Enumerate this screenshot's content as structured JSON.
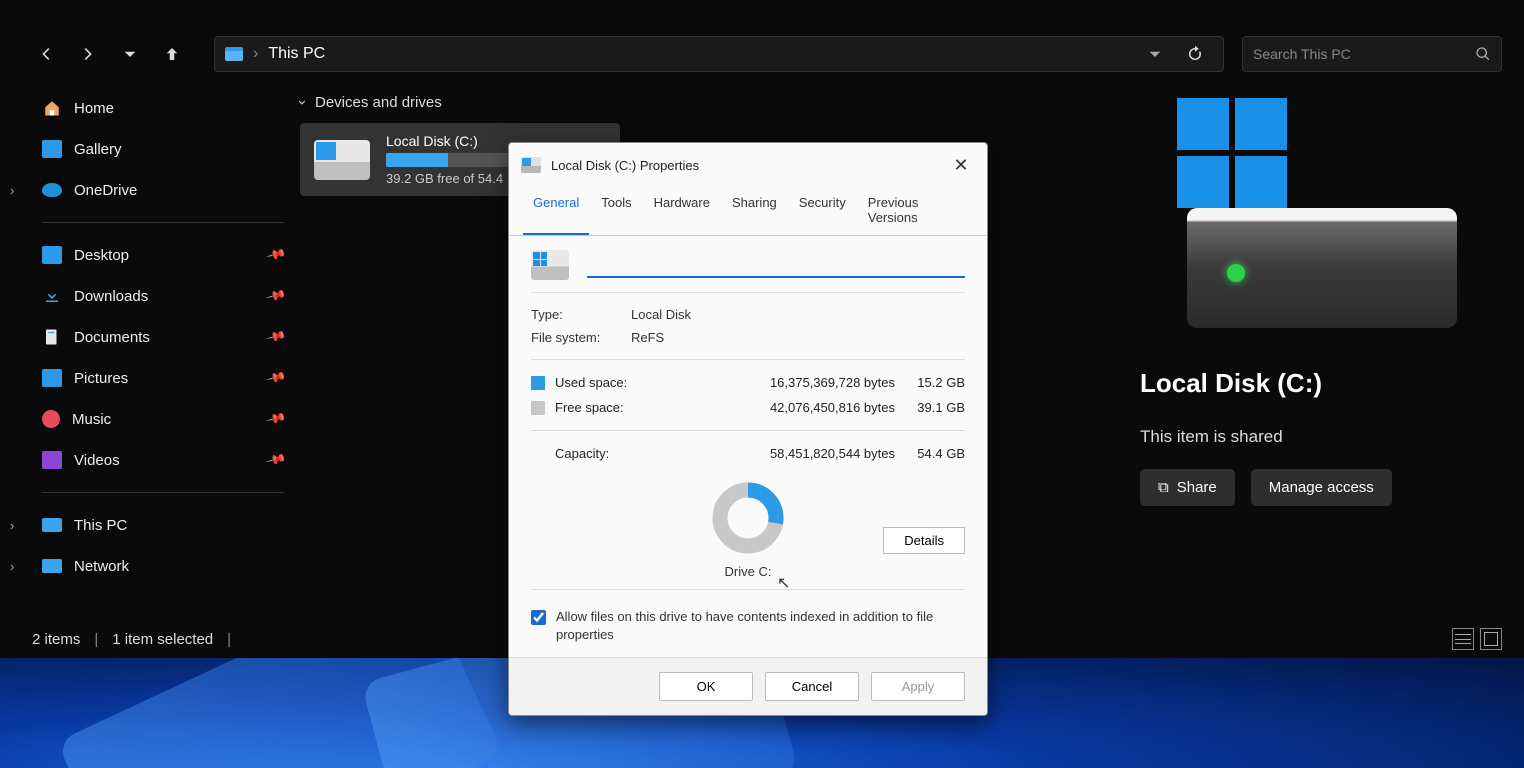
{
  "address": {
    "location": "This PC"
  },
  "search": {
    "placeholder": "Search This PC"
  },
  "sidebar": {
    "top": [
      {
        "label": "Home"
      },
      {
        "label": "Gallery"
      },
      {
        "label": "OneDrive"
      }
    ],
    "pinned": [
      {
        "label": "Desktop"
      },
      {
        "label": "Downloads"
      },
      {
        "label": "Documents"
      },
      {
        "label": "Pictures"
      },
      {
        "label": "Music"
      },
      {
        "label": "Videos"
      }
    ],
    "bottom": [
      {
        "label": "This PC"
      },
      {
        "label": "Network"
      }
    ]
  },
  "main": {
    "section_header": "Devices and drives",
    "drive": {
      "name": "Local Disk (C:)",
      "sub": "39.2 GB free of 54.4"
    }
  },
  "details": {
    "title": "Local Disk (C:)",
    "shared": "This item is shared",
    "share_btn": "Share",
    "manage_btn": "Manage access"
  },
  "status": {
    "items": "2 items",
    "selected": "1 item selected"
  },
  "dialog": {
    "title": "Local Disk (C:) Properties",
    "tabs": [
      "General",
      "Tools",
      "Hardware",
      "Sharing",
      "Security",
      "Previous Versions"
    ],
    "type_label": "Type:",
    "type_value": "Local Disk",
    "fs_label": "File system:",
    "fs_value": "ReFS",
    "used_label": "Used space:",
    "used_bytes": "16,375,369,728 bytes",
    "used_hr": "15.2 GB",
    "free_label": "Free space:",
    "free_bytes": "42,076,450,816 bytes",
    "free_hr": "39.1 GB",
    "cap_label": "Capacity:",
    "cap_bytes": "58,451,820,544 bytes",
    "cap_hr": "54.4 GB",
    "drive_letter": "Drive C:",
    "details_btn": "Details",
    "index_label": "Allow files on this drive to have contents indexed in addition to file properties",
    "ok": "OK",
    "cancel": "Cancel",
    "apply": "Apply"
  },
  "chart_data": {
    "type": "pie",
    "title": "Drive C:",
    "series": [
      {
        "name": "Used space",
        "value": 15.2,
        "unit": "GB",
        "color": "#2d9ae8"
      },
      {
        "name": "Free space",
        "value": 39.1,
        "unit": "GB",
        "color": "#c8c8c8"
      }
    ],
    "total": 54.4
  }
}
